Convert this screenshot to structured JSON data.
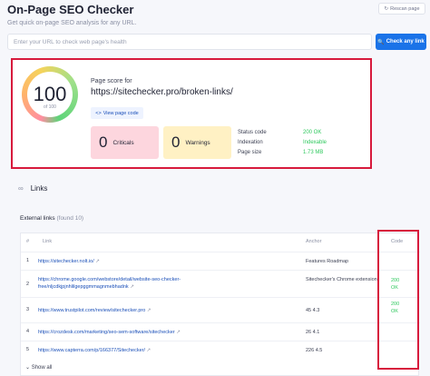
{
  "header": {
    "title": "On-Page SEO Checker",
    "subtitle": "Get quick on-page SEO analysis for any URL.",
    "rescan_label": "Rescan page"
  },
  "search": {
    "placeholder": "Enter your URL to check web page's health",
    "button_label": "Check any link"
  },
  "score": {
    "value": "100",
    "of_label": "of 100",
    "for_label": "Page score for",
    "url": "https://sitechecker.pro/broken-links/",
    "view_code_label": "View page code",
    "criticals_count": "0",
    "criticals_label": "Criticals",
    "warnings_count": "0",
    "warnings_label": "Warnings",
    "stats": [
      {
        "label": "Status code",
        "value": "200 OK"
      },
      {
        "label": "Indexation",
        "value": "Indexable"
      },
      {
        "label": "Page size",
        "value": "1.73 MB"
      }
    ]
  },
  "links": {
    "section_title": "Links",
    "external_label": "External links",
    "external_count": "(found 10)",
    "columns": {
      "num": "#",
      "link": "Link",
      "anchor": "Anchor",
      "code": "Code"
    },
    "rows": [
      {
        "num": "1",
        "link": "https://sitechecker.nolt.io/",
        "anchor": "Features Roadmap",
        "code": ""
      },
      {
        "num": "2",
        "link": "https://chrome.google.com/webstore/detail/website-seo-checker-free/nljcdkjpjnhlilgepggmmagnmebhadnk",
        "anchor": "Sitechecker's Chrome extension",
        "code": "200 OK"
      },
      {
        "num": "3",
        "link": "https://www.trustpilot.com/review/sitechecker.pro",
        "anchor": "45 4.3",
        "code": "200 OK"
      },
      {
        "num": "4",
        "link": "https://crozdesk.com/marketing/seo-sem-software/sitechecker",
        "anchor": "26 4.1",
        "code": ""
      },
      {
        "num": "5",
        "link": "https://www.capterra.com/p/166377/Sitechecker/",
        "anchor": "226 4.5",
        "code": ""
      }
    ],
    "show_all_label": "Show all"
  },
  "colors": {
    "accent": "#1a73e8",
    "highlight_border": "#d71a3c",
    "ok_green": "#2fc95e",
    "criticals_bg": "#fdd6de",
    "warnings_bg": "#fff1c4"
  }
}
